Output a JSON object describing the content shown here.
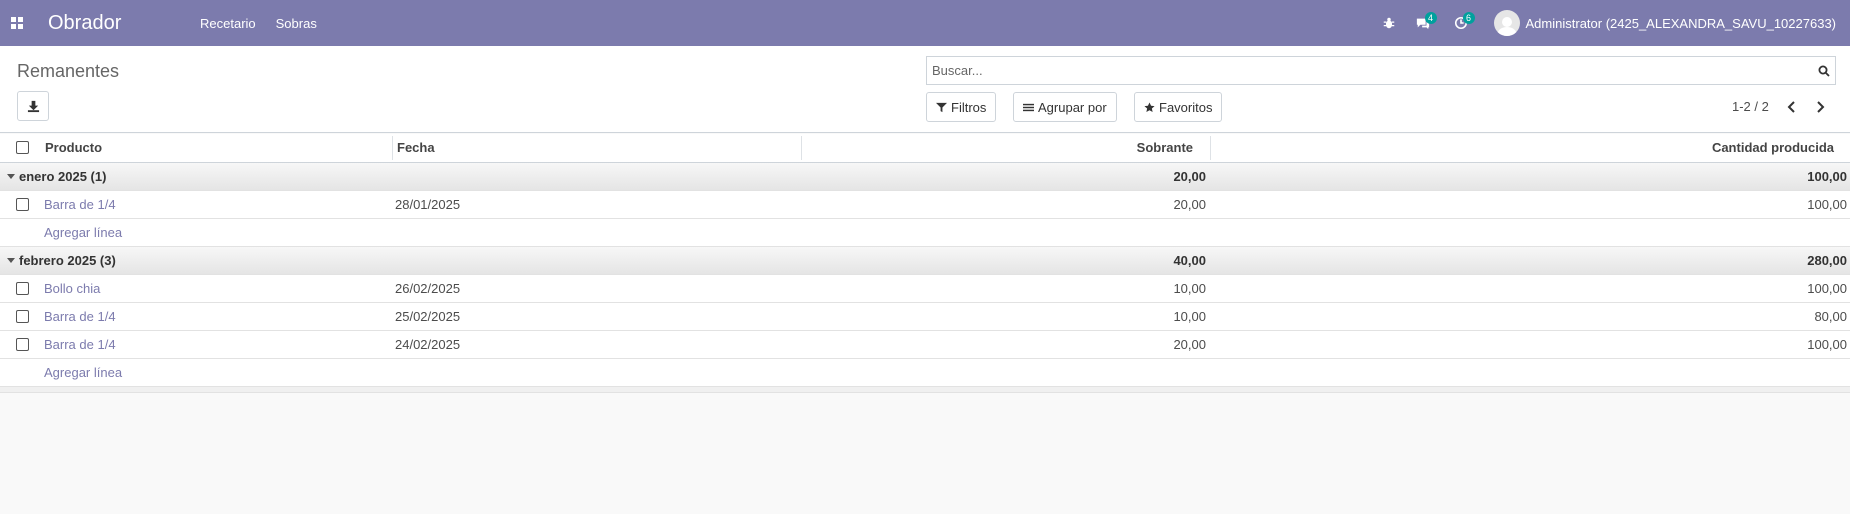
{
  "navbar": {
    "app_name": "Obrador",
    "menu": [
      "Recetario",
      "Sobras"
    ],
    "messages_count": "4",
    "activities_count": "6",
    "user_name": "Administrator (2425_ALEXANDRA_SAVU_10227633)"
  },
  "control": {
    "title": "Remanentes",
    "search_placeholder": "Buscar...",
    "filters_label": "Filtros",
    "group_by_label": "Agrupar por",
    "favorites_label": "Favoritos",
    "pager": "1-2 / 2"
  },
  "table": {
    "headers": {
      "product": "Producto",
      "date": "Fecha",
      "remaining": "Sobrante",
      "produced": "Cantidad producida"
    },
    "add_line_label": "Agregar línea",
    "groups": [
      {
        "label": "enero 2025 (1)",
        "remaining_total": "20,00",
        "produced_total": "100,00",
        "rows": [
          {
            "product": "Barra de 1/4",
            "date": "28/01/2025",
            "remaining": "20,00",
            "produced": "100,00"
          }
        ]
      },
      {
        "label": "febrero 2025 (3)",
        "remaining_total": "40,00",
        "produced_total": "280,00",
        "rows": [
          {
            "product": "Bollo chia",
            "date": "26/02/2025",
            "remaining": "10,00",
            "produced": "100,00"
          },
          {
            "product": "Barra de 1/4",
            "date": "25/02/2025",
            "remaining": "10,00",
            "produced": "80,00"
          },
          {
            "product": "Barra de 1/4",
            "date": "24/02/2025",
            "remaining": "20,00",
            "produced": "100,00"
          }
        ]
      }
    ]
  }
}
